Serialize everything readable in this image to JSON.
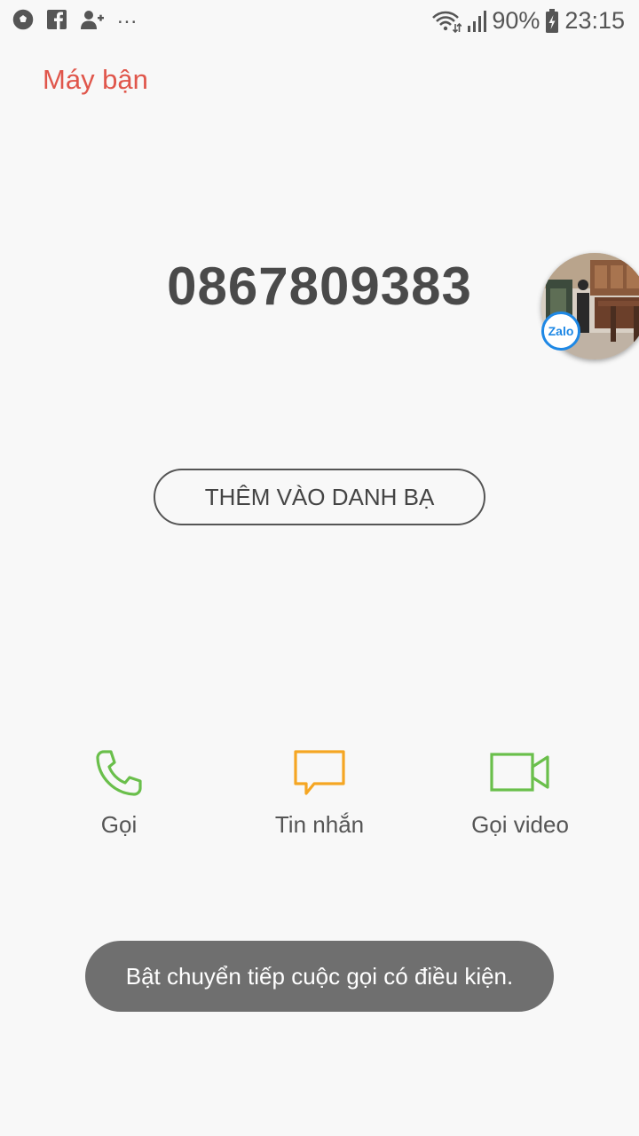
{
  "status_bar": {
    "left_icons": [
      "soccer-ball-icon",
      "facebook-icon",
      "add-user-icon"
    ],
    "overflow": "...",
    "battery": "90%",
    "time": "23:15"
  },
  "header": {
    "title": "Máy bận"
  },
  "caller": {
    "number": "0867809383"
  },
  "zalo_bubble": {
    "badge": "Zalo"
  },
  "add_contact": {
    "label": "THÊM VÀO DANH BẠ"
  },
  "actions": [
    {
      "label": "Gọi",
      "icon": "phone-icon",
      "color": "#6abf4b"
    },
    {
      "label": "Tin nhắn",
      "icon": "message-icon",
      "color": "#f5a623"
    },
    {
      "label": "Gọi video",
      "icon": "video-icon",
      "color": "#6abf4b"
    }
  ],
  "toast": {
    "message": "Bật chuyển tiếp cuộc gọi có điều kiện."
  },
  "colors": {
    "accent": "#e0564b",
    "background": "#f8f8f8"
  }
}
